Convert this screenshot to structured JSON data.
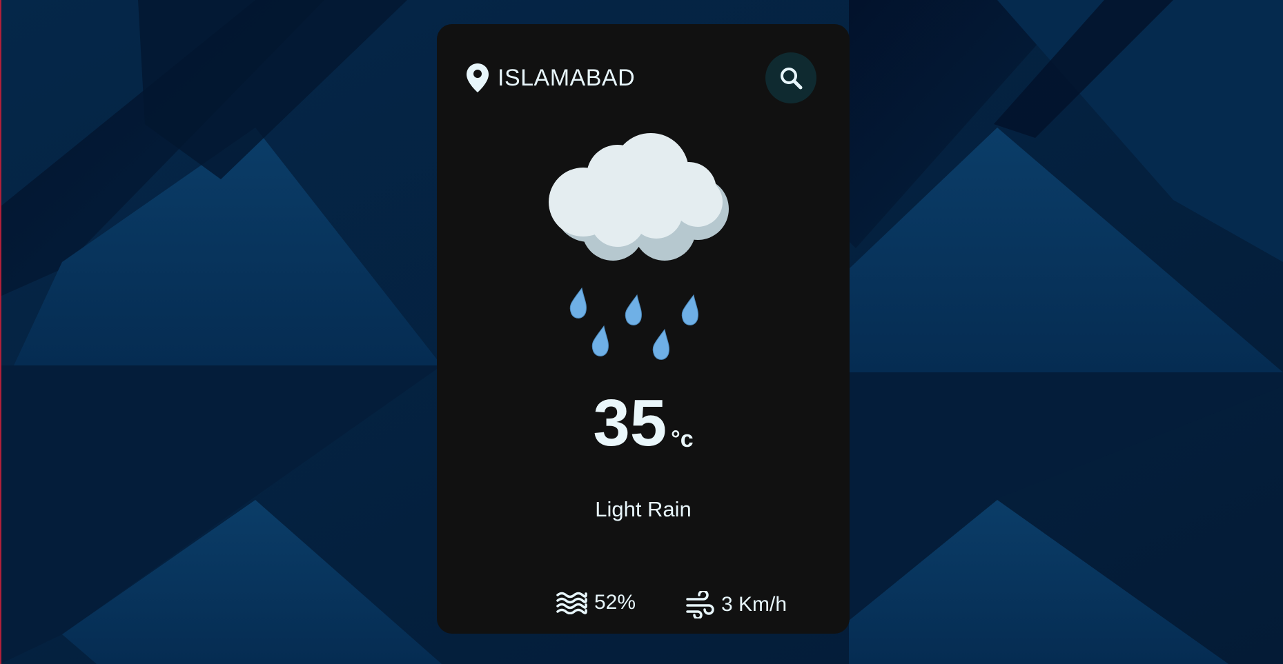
{
  "location": {
    "city": "ISLAMABAD",
    "icon": "map-pin-icon"
  },
  "search": {
    "icon": "search-icon"
  },
  "weather": {
    "icon": "rain-cloud-icon",
    "temperature": "35",
    "unit": "°c",
    "condition": "Light Rain"
  },
  "stats": {
    "humidity": {
      "icon": "humidity-waves-icon",
      "value": "52%"
    },
    "wind": {
      "icon": "wind-icon",
      "value": "3 Km/h"
    }
  },
  "colors": {
    "card_background": "#111111",
    "text": "#e8f6fb",
    "search_button": "#0f2a30",
    "page_background": "#06203d",
    "raindrop": "#6fb0e6",
    "cloud": "#e4edf0"
  }
}
